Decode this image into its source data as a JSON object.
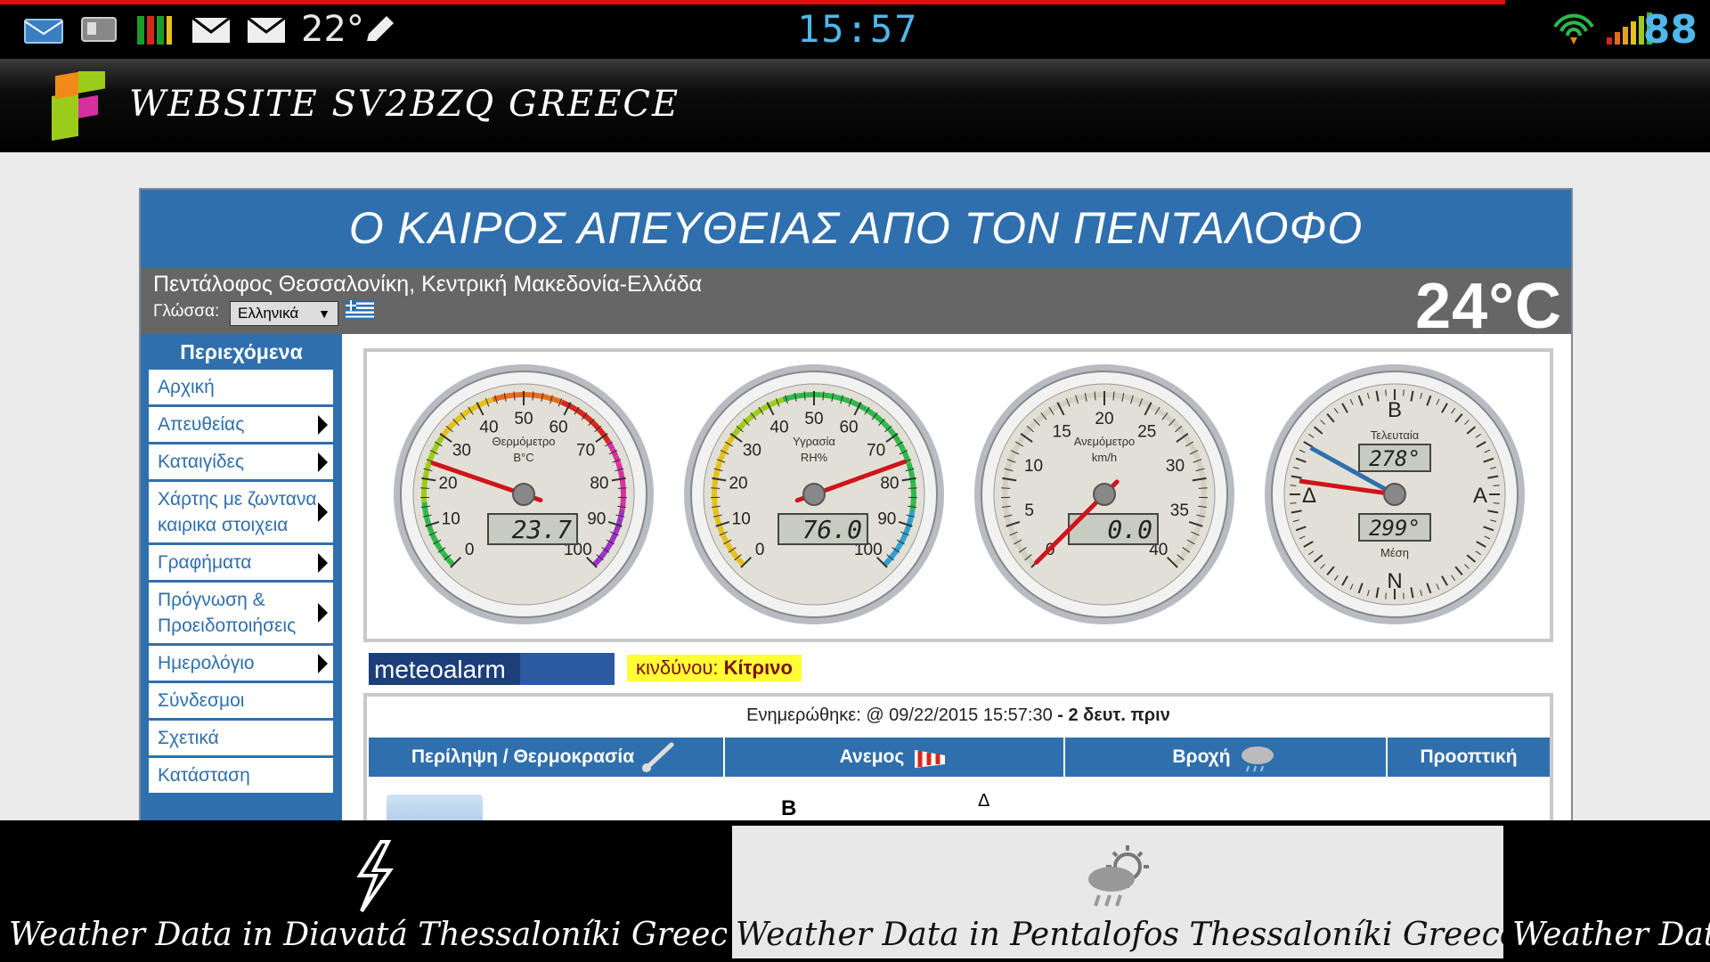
{
  "status_bar": {
    "temperature": "22°",
    "time": "15:57",
    "battery": "88",
    "icons": [
      "email-icon",
      "storage-icon",
      "equalizer-icon",
      "mail-icon",
      "mail-icon",
      "pencil-icon",
      "wifi-icon",
      "signal-icon"
    ]
  },
  "app_bar": {
    "title": "WEBSITE SV2BZQ GREECE"
  },
  "site": {
    "header": "Ο ΚΑΙΡΟΣ ΑΠΕΥΘΕΙΑΣ ΑΠΟ ΤΟΝ ΠΕΝΤΑΛΟΦΟ",
    "location": "Πεντάλοφος Θεσσαλονίκη, Κεντρική Μακεδονία-Ελλάδα",
    "language_label": "Γλώσσα:",
    "language_value": "Ελληνικά",
    "current_temp": "24°C"
  },
  "sidebar": {
    "title": "Περιεχόμενα",
    "items": [
      {
        "label": "Αρχική",
        "submenu": false
      },
      {
        "label": "Απευθείας",
        "submenu": true
      },
      {
        "label": "Καταιγίδες",
        "submenu": true
      },
      {
        "label": "Χάρτης με ζωντανα καιρικα στοιχεια",
        "submenu": true
      },
      {
        "label": "Γραφήματα",
        "submenu": true
      },
      {
        "label": "Πρόγνωση & Προειδοποιήσεις",
        "submenu": true
      },
      {
        "label": "Ημερολόγιο",
        "submenu": true
      },
      {
        "label": "Σύνδεσμοι",
        "submenu": false
      },
      {
        "label": "Σχετικά",
        "submenu": false
      },
      {
        "label": "Κατάσταση",
        "submenu": false
      }
    ]
  },
  "gauges": {
    "thermometer": {
      "title": "Θερμόμετρο",
      "unit": "B°C",
      "value": "23.7",
      "min": 0,
      "max": 100,
      "needle": 23.7,
      "ticks": [
        "0",
        "10",
        "20",
        "30",
        "40",
        "50",
        "60",
        "70",
        "80",
        "90",
        "100"
      ]
    },
    "humidity": {
      "title": "Υγρασία",
      "unit": "RH%",
      "value": "76.0",
      "min": 0,
      "max": 100,
      "needle": 76.0,
      "ticks": [
        "0",
        "10",
        "20",
        "30",
        "40",
        "50",
        "60",
        "70",
        "80",
        "90",
        "100"
      ]
    },
    "wind": {
      "title": "Ανεμόμετρο",
      "unit": "km/h",
      "value": "0.0",
      "min": 0,
      "max": 40,
      "needle": 0.0,
      "ticks": [
        "0",
        "5",
        "10",
        "15",
        "20",
        "25",
        "30",
        "35",
        "40"
      ]
    },
    "direction": {
      "title": "Τελευταία",
      "latest": "278°",
      "average_label": "Μέση",
      "average": "299°",
      "cardinals": [
        "B",
        "A",
        "N",
        "Δ"
      ]
    }
  },
  "alarm": {
    "logo_text": "meteoalarm",
    "prefix": "κινδύνου:",
    "level": "Κίτρινο",
    "level_color": "#ffff33"
  },
  "updated": {
    "prefix": "Ενημερώθηκε: @ 09/22/2015 15:57:30",
    "ago": "- 2 δευτ. πριν"
  },
  "table": {
    "headers": [
      "Περίληψη / Θερμοκρασία",
      "Ανεμος",
      "Βροχή",
      "Προοπτική"
    ],
    "wind_cell": "B",
    "wind_cell_2": "Δ"
  },
  "bottom_tabs": [
    {
      "label": "Weather Data in Diavatá Thessaloníki Greece",
      "icon": "lightning-icon"
    },
    {
      "label": "Weather Data in Pentalofos Thessaloníki Greece",
      "icon": "rain-cloud-sun-icon"
    },
    {
      "label": "Weather Data",
      "icon": ""
    }
  ],
  "colors": {
    "accent": "#2f6fad",
    "status_accent": "#4fb8e8",
    "alarm": "#ffff33"
  }
}
